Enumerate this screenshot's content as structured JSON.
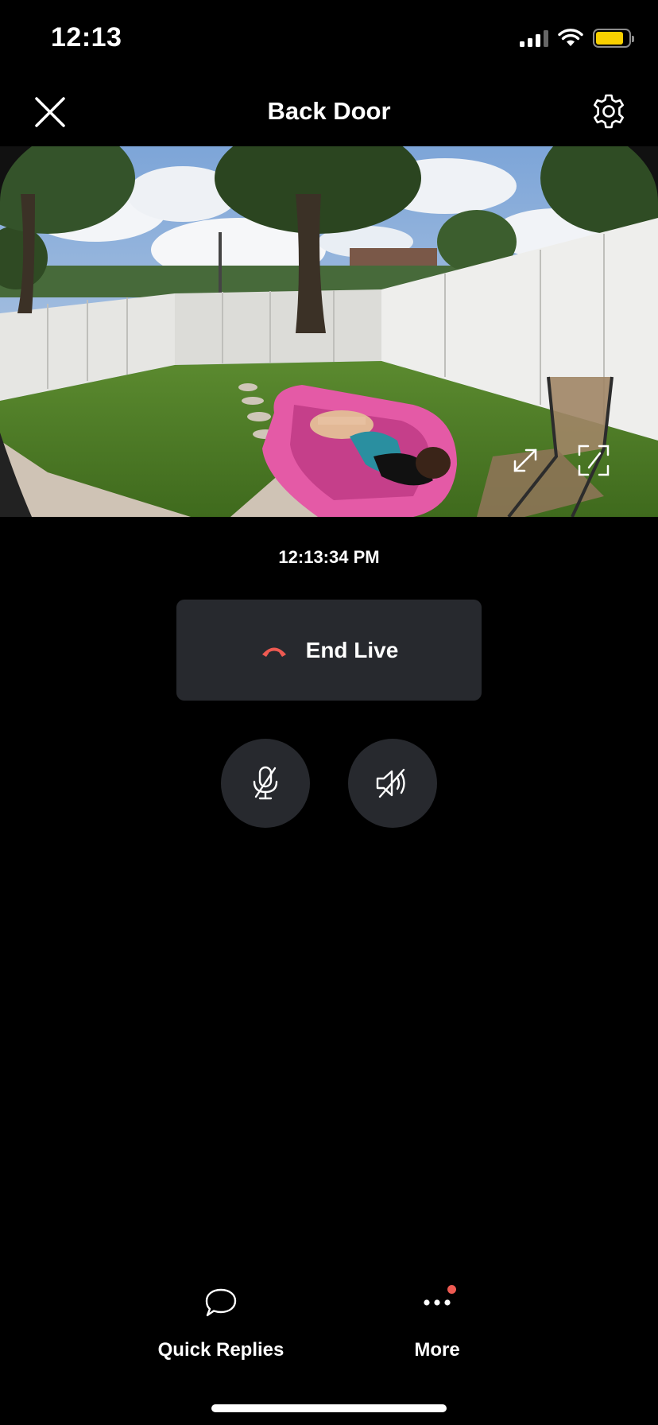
{
  "status_bar": {
    "time": "12:13",
    "icons": [
      "cellular-signal-icon",
      "wifi-icon",
      "battery-icon"
    ],
    "battery_color": "#f8d000",
    "battery_level": 0.85
  },
  "header": {
    "title": "Back Door",
    "close_icon": "close-icon",
    "settings_icon": "gear-icon"
  },
  "video": {
    "expand_icon": "expand-arrows-icon",
    "fullscreen_icon": "fullscreen-frame-icon"
  },
  "live": {
    "timestamp": "12:13:34 PM",
    "end_live_label": "End Live",
    "end_live_icon": "hang-up-phone-icon",
    "end_live_icon_color": "#ee5a52",
    "mic_icon": "microphone-muted-icon",
    "speaker_icon": "speaker-muted-icon"
  },
  "bottom_nav": {
    "items": [
      {
        "label": "Quick Replies",
        "icon": "speech-bubble-icon"
      },
      {
        "label": "More",
        "icon": "more-dots-icon",
        "badge": true
      }
    ],
    "badge_color": "#ee5a52"
  },
  "colors": {
    "background": "#000000",
    "button_surface": "#27292e",
    "accent_red": "#ee5a52"
  }
}
